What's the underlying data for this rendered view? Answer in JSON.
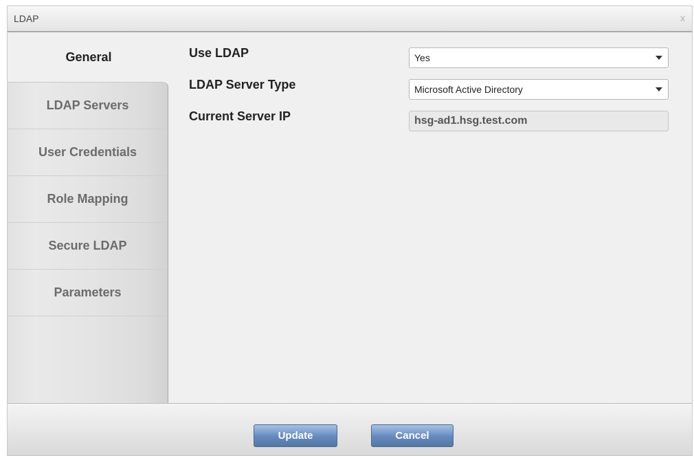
{
  "dialog": {
    "title": "LDAP",
    "close_label": "x"
  },
  "sidebar": {
    "active_tab": "General",
    "tabs": [
      {
        "label": "LDAP Servers"
      },
      {
        "label": "User Credentials"
      },
      {
        "label": "Role Mapping"
      },
      {
        "label": "Secure LDAP"
      },
      {
        "label": "Parameters"
      }
    ]
  },
  "form": {
    "use_ldap": {
      "label": "Use LDAP",
      "value": "Yes"
    },
    "server_type": {
      "label": "LDAP Server Type",
      "value": "Microsoft Active Directory"
    },
    "current_ip": {
      "label": "Current Server IP",
      "value": "hsg-ad1.hsg.test.com"
    }
  },
  "footer": {
    "update_label": "Update",
    "cancel_label": "Cancel"
  },
  "colors": {
    "button_primary": "#6589bf",
    "titlebar_border": "#a9a9a9"
  }
}
